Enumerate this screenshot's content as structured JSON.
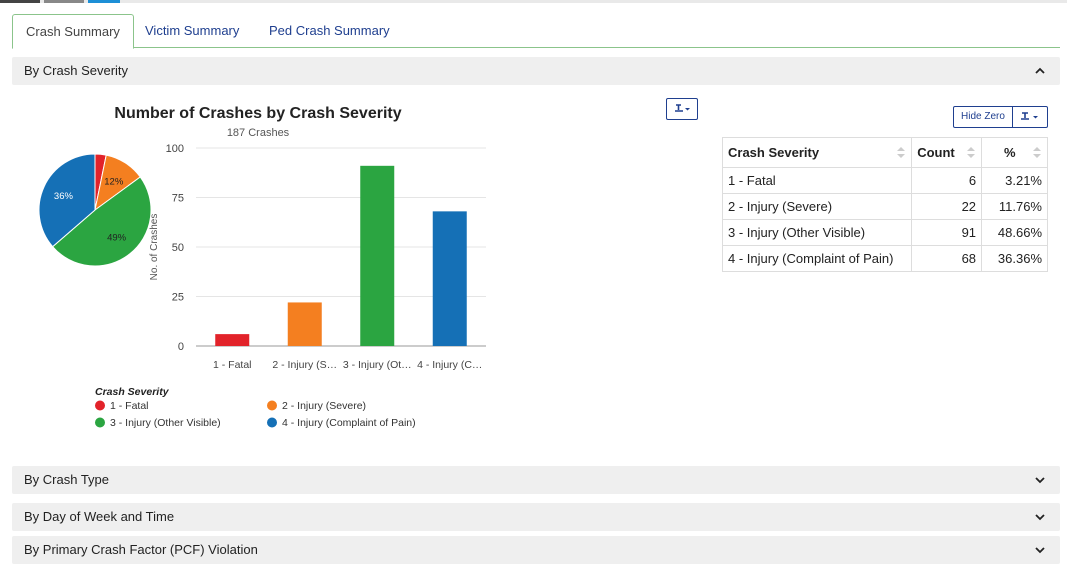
{
  "tabs": [
    {
      "label": "Crash Summary",
      "active": true
    },
    {
      "label": "Victim Summary",
      "active": false
    },
    {
      "label": "Ped Crash Summary",
      "active": false
    }
  ],
  "sections": {
    "severity": "By Crash Severity",
    "type": "By Crash Type",
    "day_time": "By Day of Week and Time",
    "pcf": "By Primary Crash Factor (PCF) Violation"
  },
  "buttons": {
    "hide_zero": "Hide Zero",
    "export_icon": "download-dropdown-icon"
  },
  "table": {
    "headers": [
      "Crash Severity",
      "Count",
      "%"
    ],
    "rows": [
      [
        "1 - Fatal",
        "6",
        "3.21%"
      ],
      [
        "2 - Injury (Severe)",
        "22",
        "11.76%"
      ],
      [
        "3 - Injury (Other Visible)",
        "91",
        "48.66%"
      ],
      [
        "4 - Injury (Complaint of Pain)",
        "68",
        "36.36%"
      ]
    ]
  },
  "colors": {
    "fatal": "#e2232a",
    "severe": "#f47f20",
    "other_visible": "#2ba541",
    "complaint": "#1570b6",
    "link": "#1f3f8f",
    "tab_border": "#8bc48b"
  },
  "chart_data": [
    {
      "type": "bar",
      "title": "Number of Crashes by Crash Severity",
      "subtitle": "187 Crashes",
      "categories": [
        "1 - Fatal",
        "2 - Injury (S…",
        "3 - Injury (Ot…",
        "4 - Injury (C…"
      ],
      "values": [
        6,
        22,
        91,
        68
      ],
      "ylabel": "No. of Crashes",
      "xlabel": "",
      "ylim": [
        0,
        100
      ],
      "yticks": [
        0,
        25,
        50,
        75,
        100
      ],
      "grid": true,
      "legend": {
        "title": "Crash Severity",
        "placement": "bottom-left",
        "entries": [
          "1 - Fatal",
          "2 - Injury (Severe)",
          "3 - Injury (Other Visible)",
          "4 - Injury (Complaint of Pain)"
        ]
      }
    },
    {
      "type": "pie",
      "labels": [
        "1 - Fatal",
        "2 - Injury (Severe)",
        "3 - Injury (Other Visible)",
        "4 - Injury (Complaint of Pain)"
      ],
      "values": [
        3.21,
        11.76,
        48.66,
        36.36
      ],
      "data_labels": [
        "",
        "12%",
        "49%",
        "36%"
      ]
    }
  ]
}
